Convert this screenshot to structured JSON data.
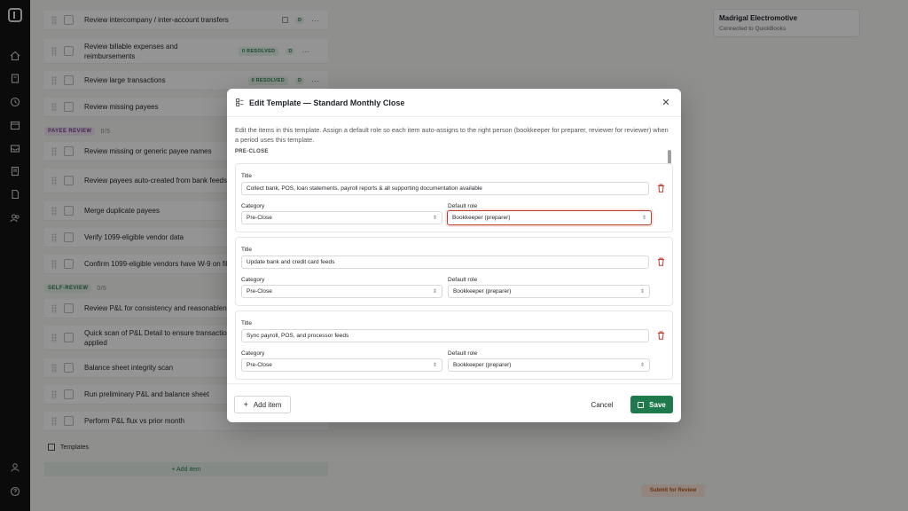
{
  "rail": {
    "icons": [
      "home-icon",
      "clipboard-icon",
      "clock-icon",
      "calendar-icon",
      "inbox-icon",
      "book-icon",
      "document-icon",
      "users-icon",
      "user-icon",
      "help-icon"
    ]
  },
  "background": {
    "tasks_top": [
      {
        "title": "Review intercompany / inter-account transfers",
        "badge": "",
        "avatar": "D"
      },
      {
        "title": "Review billable expenses and reimbursements",
        "badge": "0 RESOLVED",
        "avatar": "D"
      },
      {
        "title": "Review large transactions",
        "badge": "0 RESOLVED",
        "avatar": "D"
      },
      {
        "title": "Review missing payees",
        "badge": "",
        "avatar": ""
      }
    ],
    "section_payee": {
      "tag": "PAYEE REVIEW",
      "count": "0/5"
    },
    "tasks_payee": [
      {
        "title": "Review missing or generic payee names"
      },
      {
        "title": "Review payees auto-created from bank feeds and default account"
      },
      {
        "title": "Merge duplicate payees"
      },
      {
        "title": "Verify 1099-eligible vendor data"
      },
      {
        "title": "Confirm 1099-eligible vendors have W-9 on file"
      }
    ],
    "section_self": {
      "tag": "SELF-REVIEW",
      "count": "0/5"
    },
    "tasks_self": [
      {
        "title": "Review P&L for consistency and reasonablenes"
      },
      {
        "title": "Quick scan of P&L Detail to ensure transaction coded and all have payees applied"
      },
      {
        "title": "Balance sheet integrity scan"
      },
      {
        "title": "Run preliminary P&L and balance sheet"
      },
      {
        "title": "Perform P&L flux vs prior month"
      }
    ],
    "templates_label": "Templates",
    "add_task_label": "+ Add item",
    "company_name": "Madrigal Electromotive",
    "company_status": "Connected to QuickBooks",
    "submit_label": "Submit for Review"
  },
  "modal": {
    "title": "Edit Template — Standard Monthly Close",
    "description": "Edit the items in this template. Assign a default role so each item auto-assigns to the right person (bookkeeper for preparer, reviewer for reviewer) when a period uses this template.",
    "group_label": "PRE-CLOSE",
    "field_labels": {
      "title": "Title",
      "category": "Category",
      "role": "Default role"
    },
    "items": [
      {
        "title": "Collect bank, POS, loan statements, payroll reports & all supporting documentation available",
        "category": "Pre-Close",
        "role": "Bookkeeper (preparer)"
      },
      {
        "title": "Update bank and credit card feeds",
        "category": "Pre-Close",
        "role": "Bookkeeper (preparer)"
      },
      {
        "title": "Sync payroll, POS, and processor feeds",
        "category": "Pre-Close",
        "role": "Bookkeeper (preparer)"
      }
    ],
    "add_item_label": "Add item",
    "cancel_label": "Cancel",
    "save_label": "Save"
  }
}
